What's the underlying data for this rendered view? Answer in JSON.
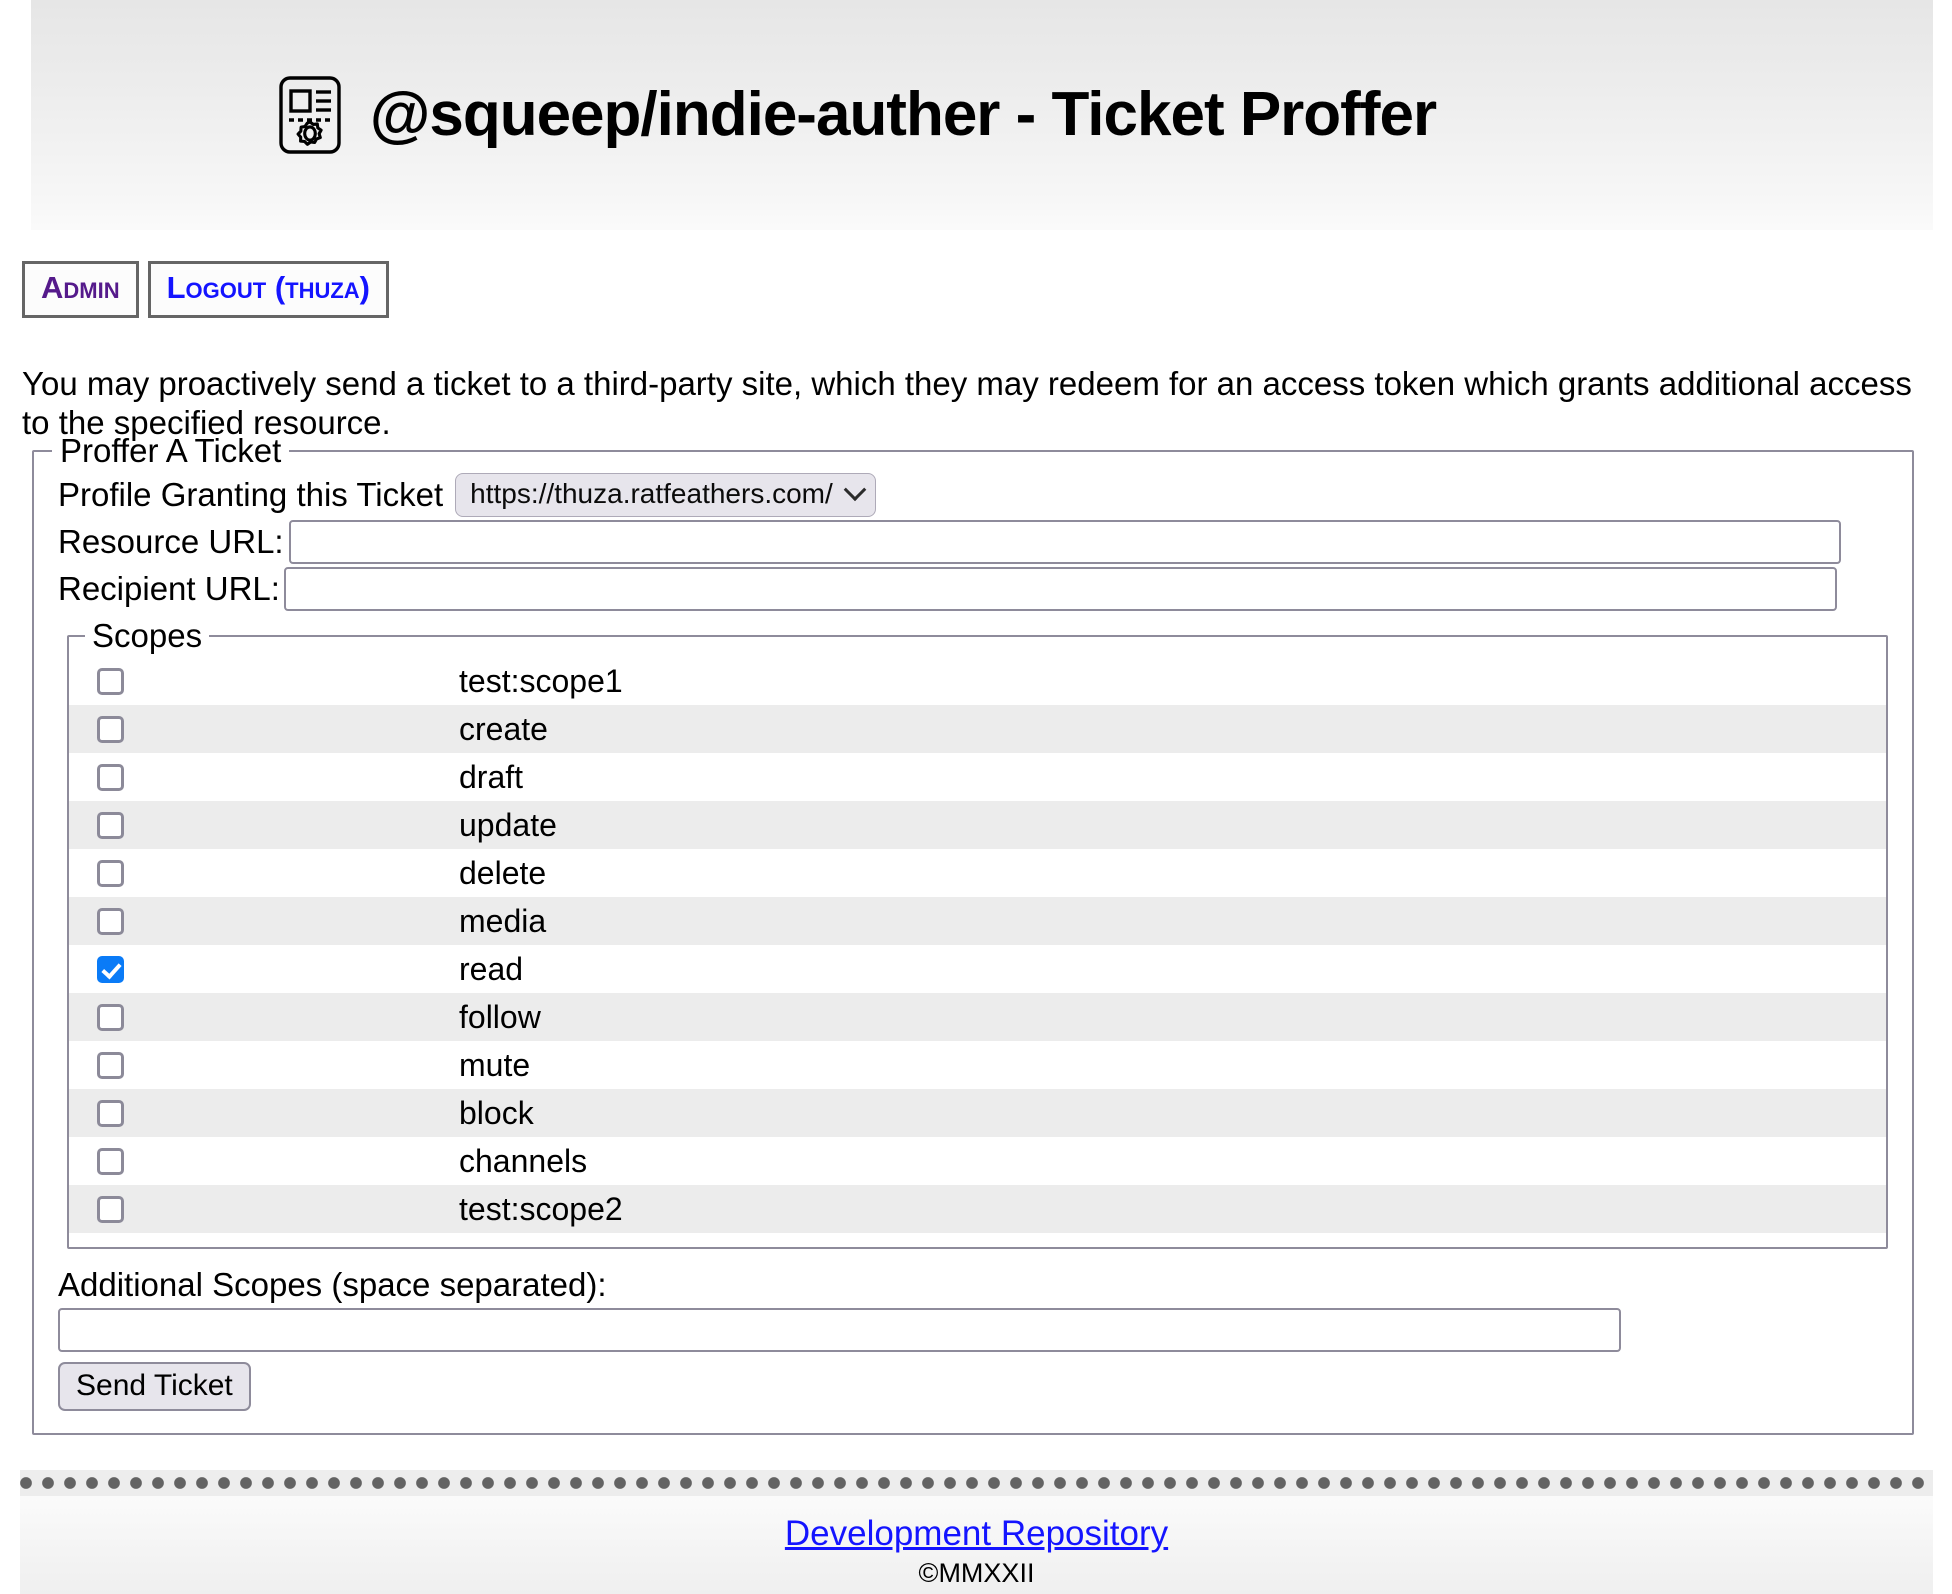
{
  "header": {
    "title": "@squeep/indie-auther - Ticket Proffer",
    "icon": "ticket-gear-icon"
  },
  "nav": {
    "items": [
      {
        "label": "Admin",
        "name": "nav-link-admin",
        "state": "visited"
      },
      {
        "label": "Logout (thuza)",
        "name": "nav-link-logout",
        "state": "unvisited"
      }
    ]
  },
  "intro": {
    "text": "You may proactively send a ticket to a third-party site, which they may redeem for an access token which grants additional access to the specified resource."
  },
  "form": {
    "legend": "Proffer A Ticket",
    "profile": {
      "label": "Profile Granting this Ticket",
      "selected": "https://thuza.ratfeathers.com/",
      "options": [
        "https://thuza.ratfeathers.com/"
      ],
      "chevron": "chevron-down-icon"
    },
    "resource_url": {
      "label": "Resource URL:",
      "value": "",
      "placeholder": ""
    },
    "recipient_url": {
      "label": "Recipient URL:",
      "value": "",
      "placeholder": ""
    },
    "scopes": {
      "legend": "Scopes",
      "items": [
        {
          "label": "test:scope1",
          "checked": false
        },
        {
          "label": "create",
          "checked": false
        },
        {
          "label": "draft",
          "checked": false
        },
        {
          "label": "update",
          "checked": false
        },
        {
          "label": "delete",
          "checked": false
        },
        {
          "label": "media",
          "checked": false
        },
        {
          "label": "read",
          "checked": true
        },
        {
          "label": "follow",
          "checked": false
        },
        {
          "label": "mute",
          "checked": false
        },
        {
          "label": "block",
          "checked": false
        },
        {
          "label": "channels",
          "checked": false
        },
        {
          "label": "test:scope2",
          "checked": false
        }
      ]
    },
    "additional_scopes": {
      "label": "Additional Scopes (space separated):",
      "value": "",
      "placeholder": ""
    },
    "submit_label": "Send Ticket"
  },
  "footer": {
    "link_label": "Development Repository",
    "copyright": "©MMXXII"
  },
  "colors": {
    "visited_link": "#551a8b",
    "link": "#1414ff",
    "checkbox_checked": "#0a7bf7",
    "border": "#8e8b9b",
    "nav_border": "#656565",
    "stripe": "#ececec"
  }
}
